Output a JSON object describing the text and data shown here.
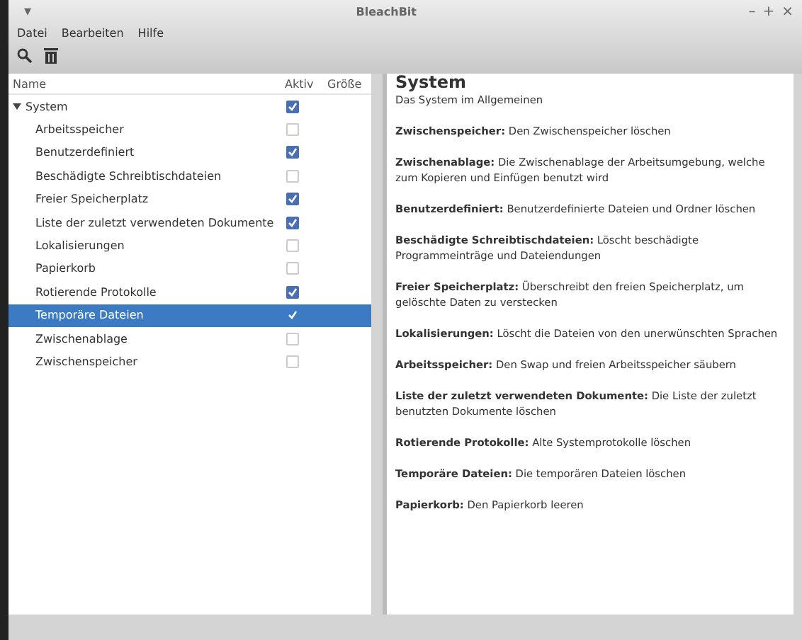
{
  "window": {
    "title": "BleachBit",
    "menu_glyph": "▾",
    "controls": [
      "–",
      "+",
      "×"
    ]
  },
  "menu": [
    "Datei",
    "Bearbeiten",
    "Hilfe"
  ],
  "tree": {
    "columns": [
      "Name",
      "Aktiv",
      "Größe"
    ],
    "items": [
      {
        "label": "System",
        "expanded": true,
        "checked": true,
        "selected": false,
        "children": [
          {
            "label": "Arbeitsspeicher",
            "checked": false,
            "selected": false
          },
          {
            "label": "Benutzerdefiniert",
            "checked": true,
            "selected": false
          },
          {
            "label": "Beschädigte Schreibtischdateien",
            "checked": false,
            "selected": false
          },
          {
            "label": "Freier Speicherplatz",
            "checked": true,
            "selected": false
          },
          {
            "label": "Liste der zuletzt verwendeten Dokumente",
            "checked": true,
            "selected": false
          },
          {
            "label": "Lokalisierungen",
            "checked": false,
            "selected": false
          },
          {
            "label": "Papierkorb",
            "checked": false,
            "selected": false
          },
          {
            "label": "Rotierende Protokolle",
            "checked": true,
            "selected": false
          },
          {
            "label": "Temporäre Dateien",
            "checked": true,
            "selected": true
          },
          {
            "label": "Zwischenablage",
            "checked": false,
            "selected": false
          },
          {
            "label": "Zwischenspeicher",
            "checked": false,
            "selected": false
          }
        ]
      }
    ]
  },
  "details": {
    "heading": "System",
    "subtitle": "Das System im Allgemeinen",
    "entries": [
      "**Zwischenspeicher:** Den Zwischenspeicher löschen",
      "**Zwischenablage:** Die Zwischenablage der Arbeitsumgebung, welche zum Kopieren und Einfügen benutzt wird",
      "**Benutzerdefiniert:** Benutzerdefinierte Dateien und Ordner löschen",
      "**Beschädigte Schreibtischdateien:** Löscht beschädigte Programmeinträge und Dateiendungen",
      "**Freier Speicherplatz:** Überschreibt den freien Speicherplatz, um gelöschte Daten zu verstecken",
      "**Lokalisierungen:** Löscht die Dateien von den unerwünschten Sprachen",
      "**Arbeitsspeicher:** Den Swap und freien Arbeitsspeicher säubern",
      "**Liste der zuletzt verwendeten Dokumente:** Die Liste der zuletzt benutzten Dokumente löschen",
      "**Rotierende Protokolle:** Alte Systemprotokolle löschen",
      "**Temporäre Dateien:** Die temporären Dateien löschen",
      "**Papierkorb:** Den Papierkorb leeren"
    ]
  }
}
